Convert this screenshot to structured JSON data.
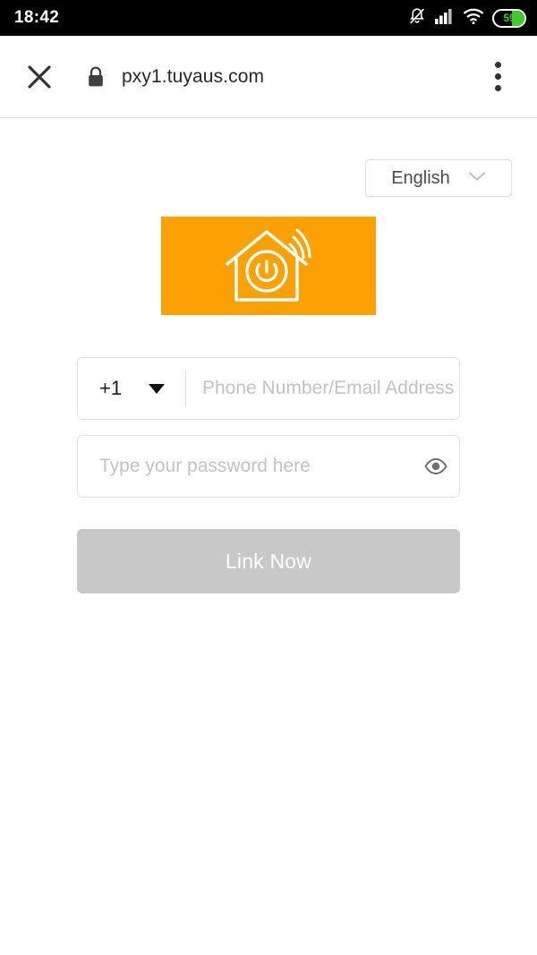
{
  "status_bar": {
    "time": "18:42",
    "battery_level": "59",
    "battery_color": "#3ccb29",
    "icons": [
      "bell-muted-icon",
      "cellular-signal-icon",
      "wifi-icon",
      "battery-icon"
    ]
  },
  "browser": {
    "url": "pxy1.tuyaus.com",
    "secure": true,
    "close_label": "×",
    "icons": [
      "close-icon",
      "lock-icon",
      "overflow-menu-icon"
    ]
  },
  "page": {
    "language": {
      "selected": "English",
      "options": [
        "English"
      ]
    },
    "logo": {
      "name": "smart-home-logo",
      "background_color": "#fca103",
      "stroke_color": "#ffffff"
    },
    "form": {
      "country_code": "+1",
      "phone_value": "",
      "phone_placeholder": "Phone Number/Email Address",
      "password_value": "",
      "password_placeholder": "Type your password here",
      "show_password_icon": "eye-icon",
      "submit_label": "Link Now",
      "submit_enabled": false,
      "submit_color": "#c8c8c8"
    }
  }
}
